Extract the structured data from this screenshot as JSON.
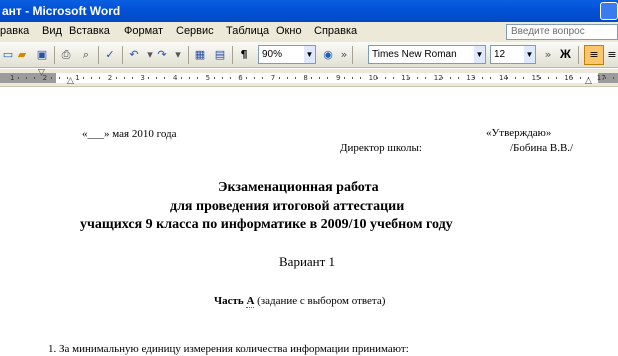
{
  "window": {
    "title": "ант - Microsoft Word"
  },
  "menu": {
    "items": [
      "равка",
      "Вид",
      "Вставка",
      "Формат",
      "Сервис",
      "Таблица",
      "Окно",
      "Справка"
    ],
    "ask_placeholder": "Введите вопрос"
  },
  "toolbar": {
    "zoom": "90%",
    "font_name": "Times New Roman",
    "font_size": "12",
    "bold_label": "Ж",
    "pilcrow": "¶"
  },
  "ruler": {
    "numbers": [
      "1",
      "2",
      "1",
      "2",
      "3",
      "4",
      "5",
      "6",
      "7",
      "8",
      "9",
      "10",
      "11",
      "12",
      "13",
      "14",
      "15",
      "16",
      "17",
      "18"
    ]
  },
  "document": {
    "date_line": "«___» мая 2010 года",
    "approve": "«Утверждаю»",
    "director_label": "Директор школы:",
    "director_name": "/Бобина В.В./",
    "title_line1": "Экзаменационная работа",
    "title_line2": "для проведения итоговой аттестации",
    "title_line3": "учащихся 9 класса по информатике в 2009/10 учебном году",
    "variant": "Вариант 1",
    "part_word": "Часть",
    "part_letter": "А",
    "part_rest": "(задание с выбором ответа)",
    "question1": "1. За минимальную единицу измерения количества информации принимают:"
  }
}
